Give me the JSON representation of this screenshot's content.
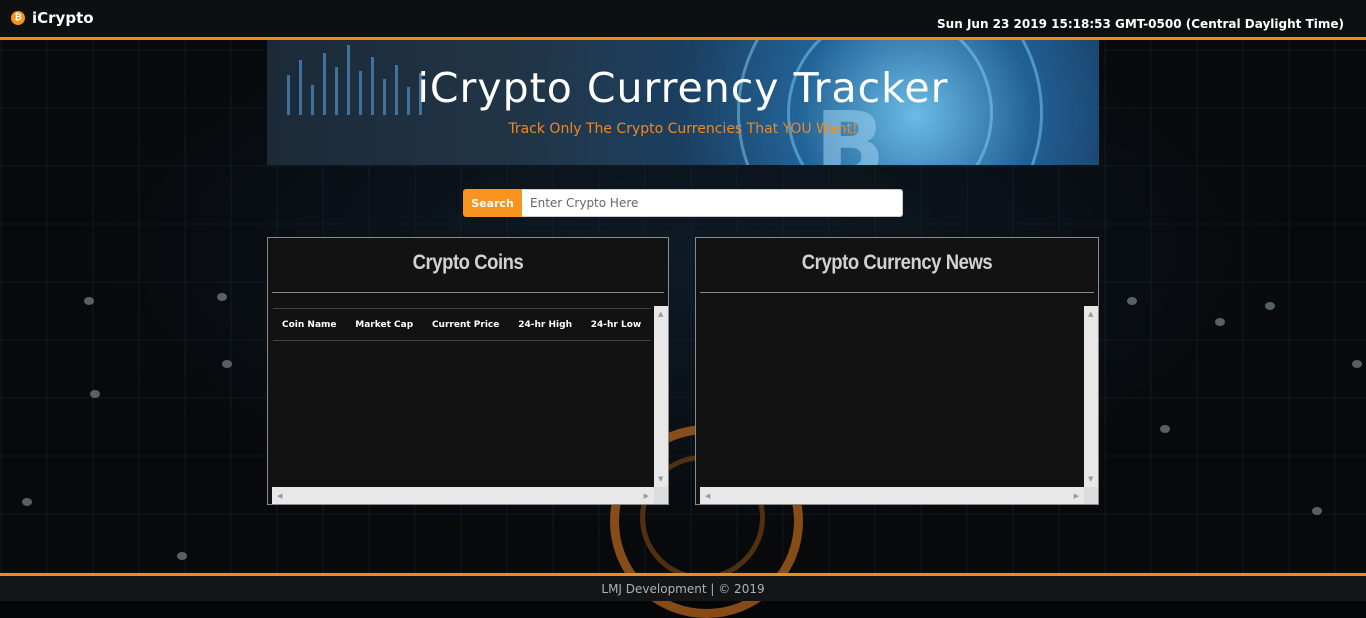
{
  "navbar": {
    "brand_icon": "₿",
    "brand_name": "iCrypto",
    "datetime": "Sun Jun 23 2019 15:18:53 GMT-0500 (Central Daylight Time)"
  },
  "banner": {
    "title": "iCrypto Currency Tracker",
    "subtitle": "Track Only The Crypto Currencies That YOU Want!",
    "bitcoin_symbol": "B"
  },
  "search": {
    "button_label": "Search",
    "placeholder": "Enter Crypto Here",
    "value": ""
  },
  "coins_panel": {
    "title": "Crypto Coins",
    "columns": [
      "Coin Name",
      "Market Cap",
      "Current Price",
      "24-hr High",
      "24-hr Low"
    ],
    "rows": []
  },
  "news_panel": {
    "title": "Crypto Currency News",
    "articles": []
  },
  "footer": {
    "text": "LMJ Development | © 2019"
  },
  "colors": {
    "accent": "#f0891e",
    "panel_bg": "#131213",
    "navbar_bg": "#0e0f10"
  }
}
